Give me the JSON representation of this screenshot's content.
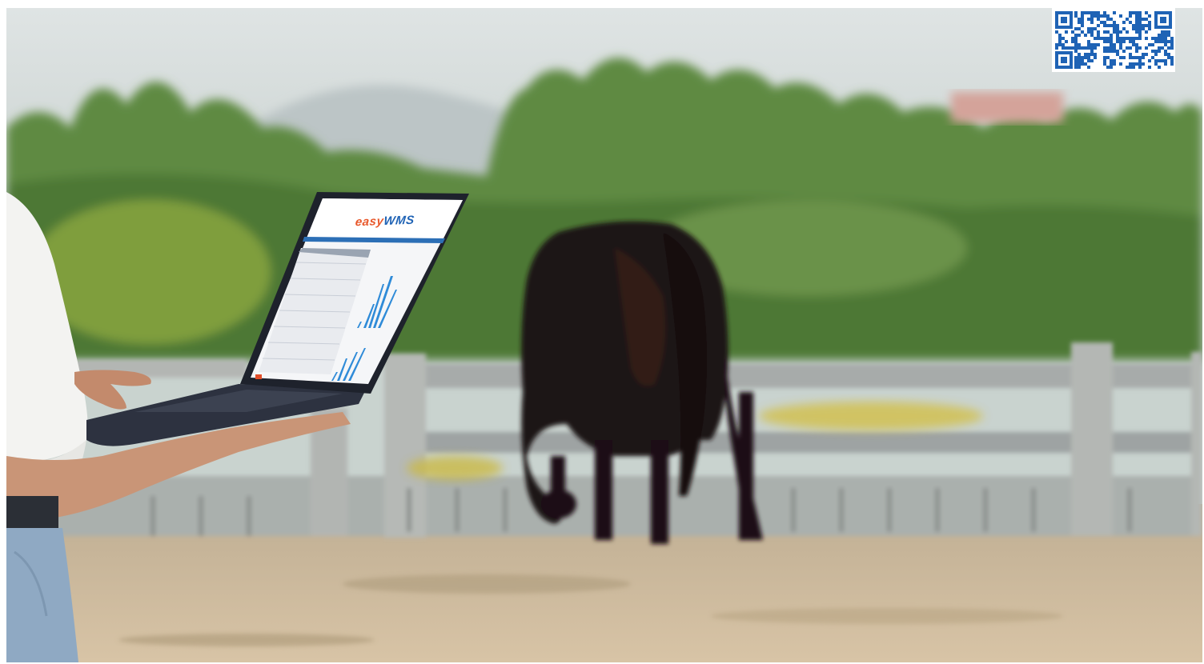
{
  "laptop_screen": {
    "logo_left": "easy",
    "logo_right": "WMS"
  },
  "colors": {
    "sky": "#d9e1e2",
    "trees": "#5f8b43",
    "fence": "#9ea3a3",
    "horse": "#1c1213",
    "ground": "#cbb597",
    "brand_orange": "#e8572a",
    "brand_blue": "#1f63b5"
  },
  "icons": [
    "qr-code-icon"
  ]
}
